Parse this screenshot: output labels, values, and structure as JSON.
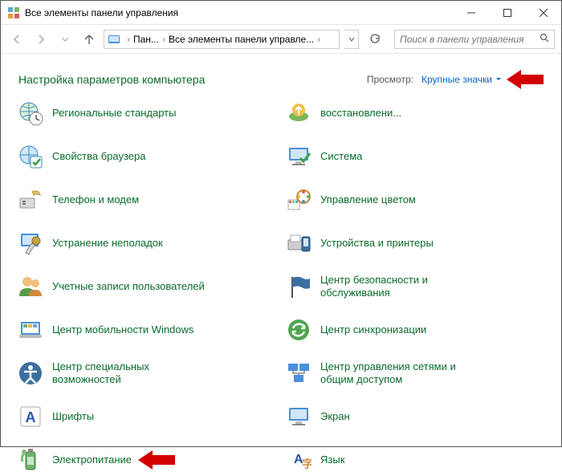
{
  "window": {
    "title": "Все элементы панели управления"
  },
  "breadcrumb": {
    "seg1": "Пан...",
    "seg2": "Все элементы панели управле..."
  },
  "search": {
    "placeholder": "Поиск в панели управления"
  },
  "heading": "Настройка параметров компьютера",
  "view": {
    "label": "Просмотр:",
    "value": "Крупные значки"
  },
  "items": {
    "left": [
      {
        "label": "Региональные стандарты",
        "icon": "globe-clock"
      },
      {
        "label": "Свойства браузера",
        "icon": "browser-check"
      },
      {
        "label": "Телефон и модем",
        "icon": "phone-modem"
      },
      {
        "label": "Устранение неполадок",
        "icon": "troubleshoot"
      },
      {
        "label": "Учетные записи пользователей",
        "icon": "users"
      },
      {
        "label": "Центр мобильности Windows",
        "icon": "mobility"
      },
      {
        "label": "Центр специальных возможностей",
        "icon": "ease-access"
      },
      {
        "label": "Шрифты",
        "icon": "fonts"
      },
      {
        "label": "Электропитание",
        "icon": "power"
      }
    ],
    "right": [
      {
        "label": "восстановлени...",
        "icon": "backup"
      },
      {
        "label": "Система",
        "icon": "system"
      },
      {
        "label": "Управление цветом",
        "icon": "color"
      },
      {
        "label": "Устройства и принтеры",
        "icon": "devices"
      },
      {
        "label": "Центр безопасности и обслуживания",
        "icon": "flag"
      },
      {
        "label": "Центр синхронизации",
        "icon": "sync"
      },
      {
        "label": "Центр управления сетями и общим доступом",
        "icon": "network"
      },
      {
        "label": "Экран",
        "icon": "display"
      },
      {
        "label": "Язык",
        "icon": "language"
      }
    ]
  }
}
